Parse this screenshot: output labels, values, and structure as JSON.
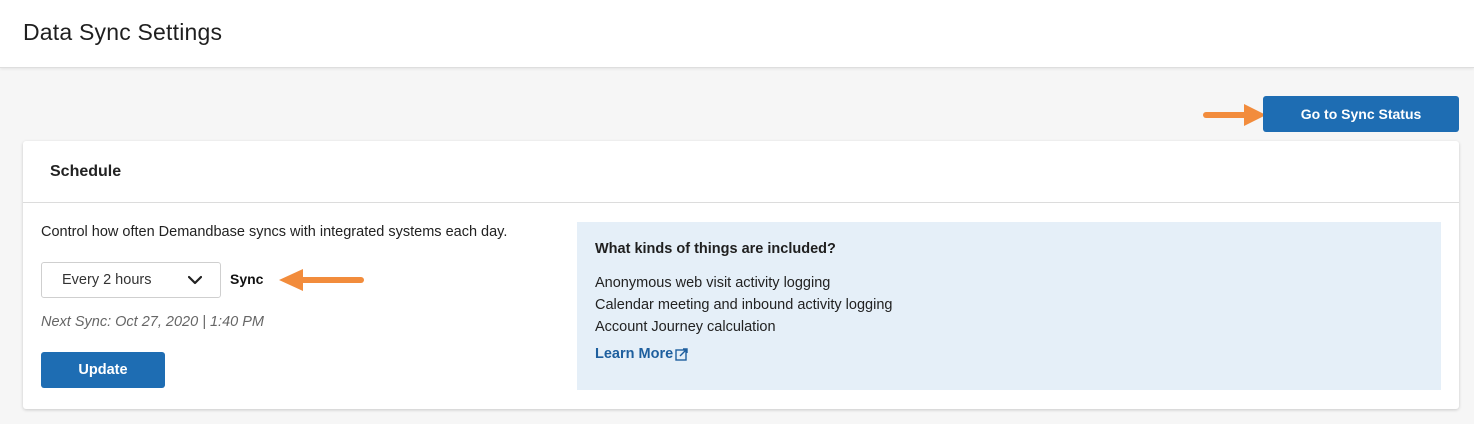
{
  "header": {
    "title": "Data Sync Settings"
  },
  "actions": {
    "sync_status_label": "Go to Sync Status"
  },
  "schedule": {
    "title": "Schedule",
    "description": "Control how often Demandbase syncs with integrated systems each day.",
    "frequency": {
      "selected": "Every 2 hours"
    },
    "sync_label": "Sync",
    "next_sync": "Next Sync: Oct 27, 2020 | 1:40 PM",
    "update_label": "Update"
  },
  "info": {
    "heading": "What kinds of things are included?",
    "items": [
      "Anonymous web visit activity logging",
      "Calendar meeting and inbound activity logging",
      "Account Journey calculation"
    ],
    "learn_more": "Learn More"
  },
  "icons": {
    "dropdown": "chevron-down-icon",
    "external_link": "external-link-icon",
    "annotation_arrow": "arrow-annotation-icon"
  },
  "colors": {
    "primary": "#1e6db3",
    "info_background": "#e5eff8",
    "link": "#1e5f9e",
    "annotation": "#f28c3c"
  }
}
